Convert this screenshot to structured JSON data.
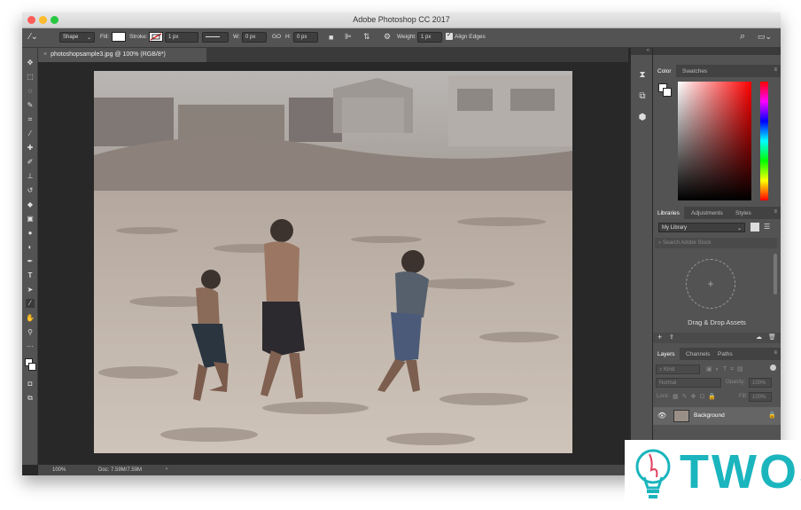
{
  "window": {
    "title": "Adobe Photoshop CC 2017"
  },
  "options_bar": {
    "mode": "Shape",
    "fill_label": "Fill:",
    "stroke_label": "Stroke:",
    "stroke_width": "1 px",
    "w_label": "W:",
    "w_value": "0 px",
    "go_label": "GO",
    "h_label": "H:",
    "h_value": "0 px",
    "weight_label": "Weight:",
    "weight_value": "1 px",
    "align_edges": "Align Edges"
  },
  "document": {
    "tab_title": "photoshopsample3.jpg @ 100% (RGB/8*)",
    "zoom": "100%",
    "doc_info": "Doc: 7.59M/7.59M"
  },
  "color_panel": {
    "tabs": [
      "Color",
      "Swatches"
    ],
    "hue_color": "#ff0000"
  },
  "libraries_panel": {
    "tabs": [
      "Libraries",
      "Adjustments",
      "Styles"
    ],
    "library_name": "My Library",
    "search_placeholder": "Search Adobe Stock",
    "drop_text": "Drag & Drop Assets"
  },
  "layers_panel": {
    "tabs": [
      "Layers",
      "Channels",
      "Paths"
    ],
    "filter_kind": "Kind",
    "blend_mode": "Normal",
    "opacity_label": "Opacity:",
    "opacity_value": "100%",
    "lock_label": "Lock:",
    "fill_label": "Fill:",
    "fill_value": "100%",
    "layers": [
      {
        "name": "Background"
      }
    ]
  },
  "watermark": {
    "text": "TWOS",
    "color": "#1bb5be"
  }
}
